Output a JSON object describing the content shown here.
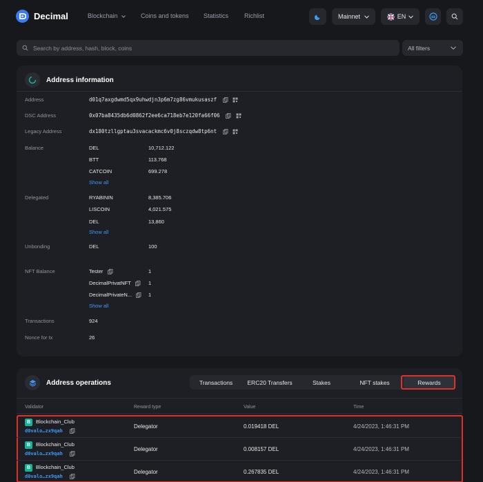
{
  "header": {
    "brand": "Decimal",
    "nav": [
      "Blockchain",
      "Coins and tokens",
      "Statistics",
      "Richlist"
    ],
    "network": "Mainnet",
    "language": "EN",
    "icons": {
      "theme": "moon-icon",
      "wallet": "wallet-icon",
      "search": "search-icon"
    }
  },
  "search": {
    "placeholder": "Search by address, hash, block, coins",
    "filter": "All filters"
  },
  "address_info": {
    "title": "Address information",
    "fields": {
      "address_label": "Address",
      "address": "d01q7axgdwmd5qx9uhwdjn3p6m7zg86vmukusaszf",
      "dsc_label": "DSC Address",
      "dsc": "0x07ba8435db6d0862f2ee6ca718eb7e120fa66f06",
      "legacy_label": "Legacy Address",
      "legacy": "dx180tzllgptau3svacackmc6v0j8sczqdw8tp6nt",
      "balance_label": "Balance",
      "balance": [
        {
          "coin": "DEL",
          "amount": "10,712.122"
        },
        {
          "coin": "BTT",
          "amount": "113.768"
        },
        {
          "coin": "CATCOIN",
          "amount": "699.278"
        }
      ],
      "show_all": "Show all",
      "delegated_label": "Delegated",
      "delegated": [
        {
          "coin": "RYABININ",
          "amount": "8,385.706"
        },
        {
          "coin": "LISCOIN",
          "amount": "4,021.575"
        },
        {
          "coin": "DEL",
          "amount": "13,860"
        }
      ],
      "unbonding_label": "Unbonding",
      "unbonding": {
        "coin": "DEL",
        "amount": "100"
      },
      "nft_label": "NFT Balance",
      "nft": [
        {
          "name": "Tester",
          "amount": "1"
        },
        {
          "name": "DecimalPrivatNFT",
          "amount": "1"
        },
        {
          "name": "DecimalPrivateN...",
          "amount": "1"
        }
      ],
      "transactions_label": "Transactions",
      "transactions": "924",
      "nonce_label": "Nonce for tx",
      "nonce": "26"
    }
  },
  "operations": {
    "title": "Address operations",
    "tabs": [
      "Transactions",
      "ERC20 Transfers",
      "Stakes",
      "NFT stakes",
      "Rewards"
    ],
    "active_tab": "Rewards",
    "columns": [
      "Validator",
      "Reward type",
      "Value",
      "Time"
    ],
    "rows": [
      {
        "validator": "Blockchain_Club",
        "addr": "d0valo…zx9qah",
        "type": "Delegator",
        "value": "0.019418 DEL",
        "time": "4/24/2023, 1:46:31 PM"
      },
      {
        "validator": "Blockchain_Club",
        "addr": "d0valo…zx9qah",
        "type": "Delegator",
        "value": "0.008157 DEL",
        "time": "4/24/2023, 1:46:31 PM"
      },
      {
        "validator": "Blockchain_Club",
        "addr": "d0valo…zx9qah",
        "type": "Delegator",
        "value": "0.267835 DEL",
        "time": "4/24/2023, 1:46:31 PM"
      }
    ]
  },
  "colors": {
    "accent": "#3d9af5",
    "highlight": "#e0302c",
    "validator_badge": "#16b394"
  }
}
